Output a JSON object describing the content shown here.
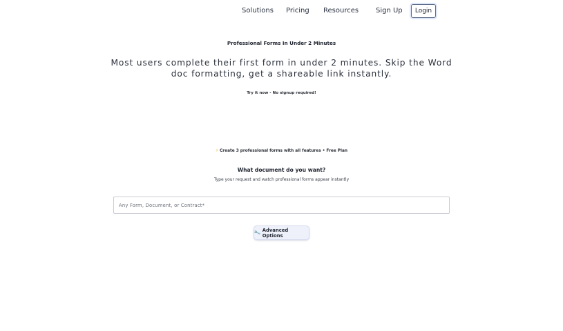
{
  "nav": {
    "links": [
      "Solutions",
      "Pricing",
      "Resources",
      "Sign Up"
    ],
    "login_label": "Login"
  },
  "hero": {
    "eyebrow": "Professional Forms In Under 2 Minutes",
    "headline": "Most users complete their first form in under 2 minutes. Skip the Word doc formatting, get a shareable link instantly.",
    "try_note": "Try it now - No signup required!"
  },
  "builder": {
    "plan_icon": "lightning-icon",
    "plan_text": "Create 3 professional forms with all features • Free Plan",
    "question": "What document do you want?",
    "subtitle": "Type your request and watch professional forms appear instantly",
    "input_label": "Any Form, Document, or Contract",
    "input_required_mark": "*",
    "advanced_icon": "wrench-icon",
    "advanced_label": "Advanced Options"
  },
  "colors": {
    "accent_border": "#5b6b8a",
    "bolt": "#f2b01e",
    "advanced_bg": "#eef1fa"
  }
}
